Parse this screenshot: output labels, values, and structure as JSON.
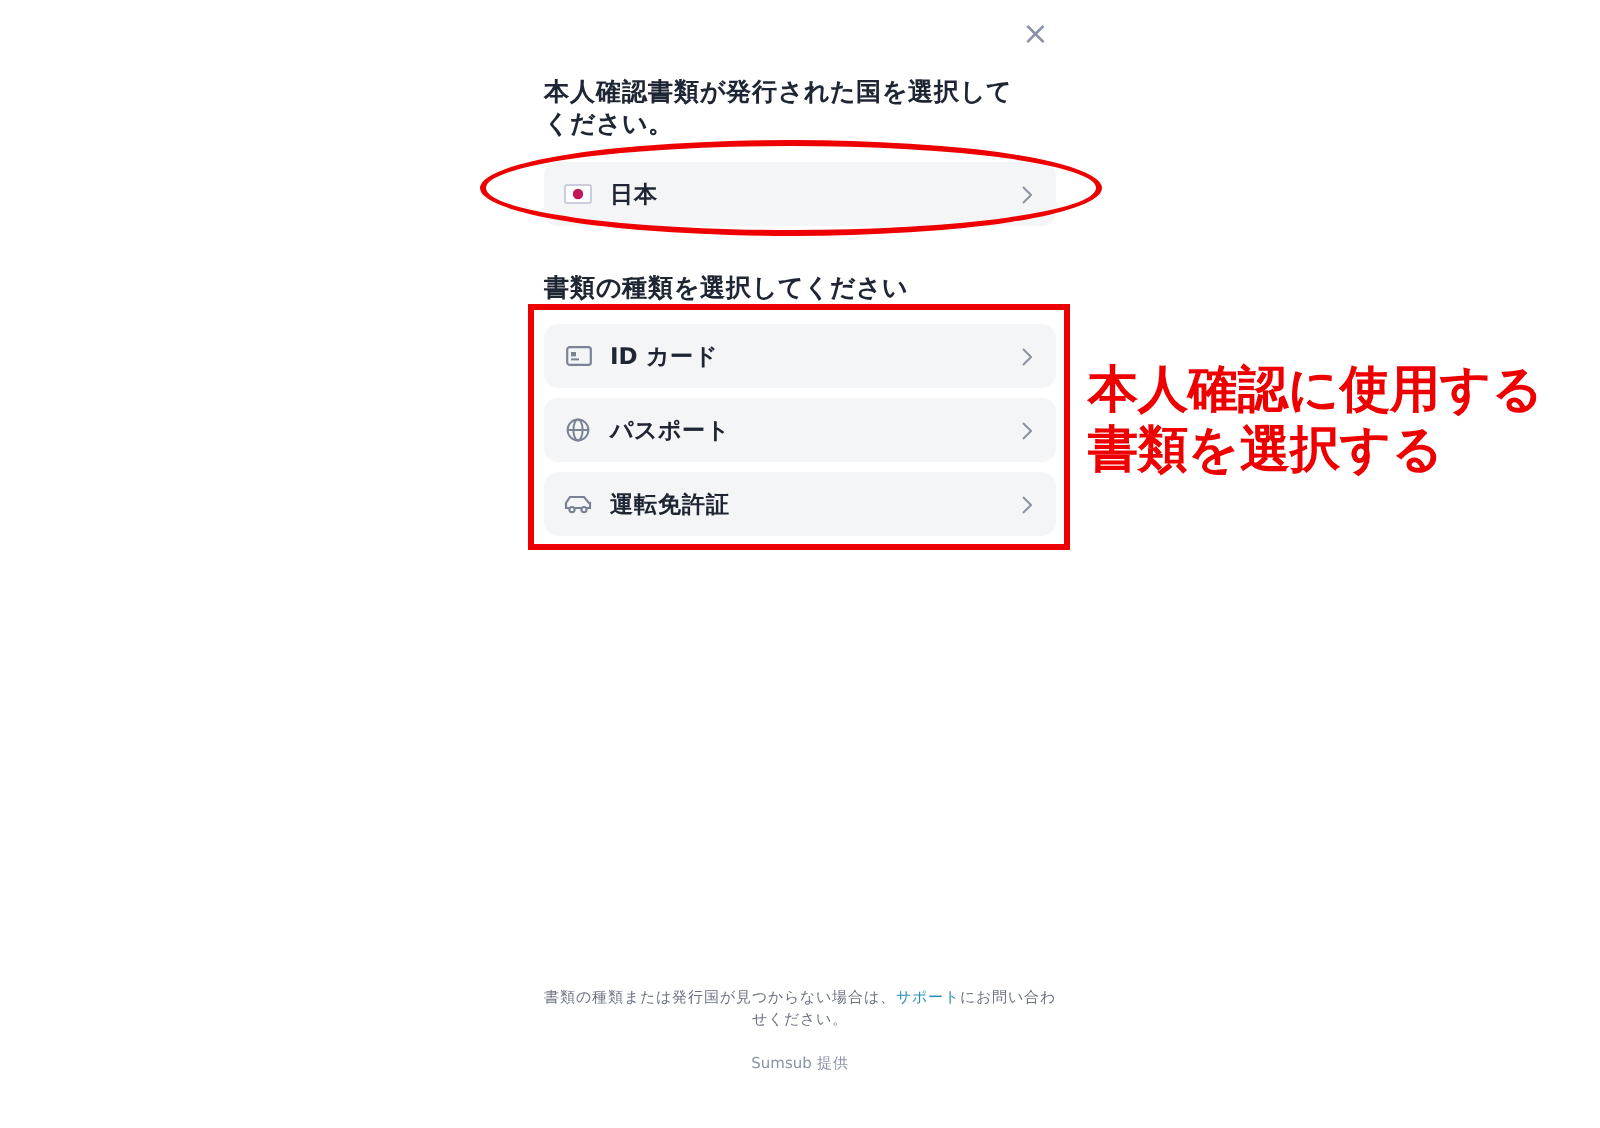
{
  "close_button": {
    "label": "×"
  },
  "country_section": {
    "title": "本人確認書類が発行された国を選択してください。",
    "country": {
      "name": "日本",
      "kind": "flag"
    }
  },
  "document_section": {
    "title": "書類の種類を選択してください",
    "documents": [
      {
        "label": "ID カード",
        "kind": "id-card"
      },
      {
        "label": "パスポート",
        "kind": "globe"
      },
      {
        "label": "運転免許証",
        "kind": "car"
      }
    ]
  },
  "annotation": {
    "text": "本人確認に使用する書類を選択する"
  },
  "footer": {
    "before": "書類の種類または発行国が見つからない場合は、",
    "link": "サポート",
    "after": "にお問い合わせください。",
    "provider": "Sumsub 提供"
  }
}
